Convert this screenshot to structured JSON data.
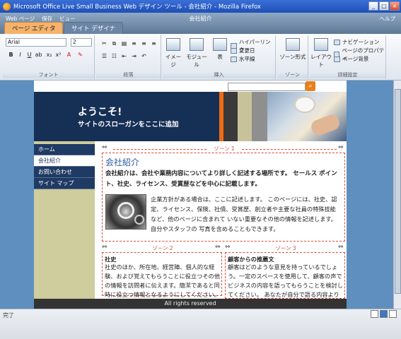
{
  "window": {
    "title": "Microsoft Office Live Small Business Web デザイン ツール - 会社紹介 - Mozilla Firefox"
  },
  "menubar": {
    "web_page": "Web ページ",
    "save": "保存",
    "view": "ビュー",
    "page_title": "会社紹介",
    "help": "ヘルプ"
  },
  "tabs": [
    {
      "label": "ページ エディタ"
    },
    {
      "label": "サイト デザイナ"
    }
  ],
  "ribbon": {
    "font_name": "Arial",
    "font_size": "2",
    "groups": {
      "font": "フォント",
      "paragraph": "段落",
      "insert": "挿入",
      "zone": "ゾーン",
      "options": "詳細設定"
    },
    "insert_buttons": {
      "image": "イメージ",
      "module": "モジュール",
      "table": "表",
      "hyperlink": "ハイパーリンク",
      "variable_date": "変更日",
      "horizontal_line": "水平線"
    },
    "zone_button": "ゾーン形式",
    "layout_button": "レイアウト",
    "options_buttons": {
      "navigation": "ナビゲーション",
      "page_properties": "ページのプロパティ",
      "page_background": "ページ背景"
    }
  },
  "banner": {
    "welcome": "ようこそ!",
    "slogan": "サイトのスローガンをここに追加"
  },
  "nav": [
    {
      "label": "ホーム"
    },
    {
      "label": "会社紹介"
    },
    {
      "label": "お問い合わせ"
    },
    {
      "label": "サイト マップ"
    }
  ],
  "zone1": {
    "label": "ゾーン 1",
    "title": "会社紹介",
    "lead": "会社紹介は、会社や業務内容についてより詳しく記述する場所です。 セールス ポイント、社史、ライセンス、受賞歴などを中心に記載します。",
    "body": "企業方針がある場合は、ここに記述します。 このページには、社史、認定、ライセンス、保険、社債、受賞歴、創立者や主要な社員の特殊技能など、他のページに含まれて いない重要なその他の情報を記述します。自分やスタッフの 写真を含めることもできます。"
  },
  "zone2": {
    "label": "ゾーン 2",
    "title": "社史",
    "body": "社史のほか、所在地、経営陣、個人的な経験、および覚えてもらうことに役立つその他の情報を訪問者に伝えます。簡潔であると同時に役立つ情報となるようにしてください。"
  },
  "zone3": {
    "label": "ゾーン 3",
    "title": "顧客からの推薦文",
    "body": "顧客はどのような意見を持っているでしょう。一定のスペースを使用して、顧客の声でビジネスの内容を語ってもらうことを検討してください。 あなたが自分で語る内容よりも、顧客の言葉の方がより説得力があります。"
  },
  "footer": {
    "text": "All rights reserved"
  },
  "status": {
    "text": "完了"
  }
}
